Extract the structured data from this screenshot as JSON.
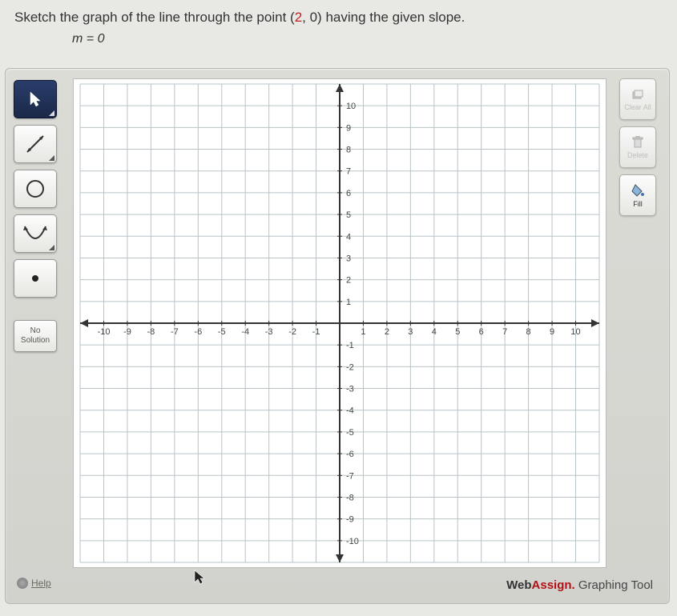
{
  "question": {
    "prefix": "Sketch the graph of the line through the point (",
    "point_x": "2",
    "mid": ", 0) having the given slope.",
    "equation": "m = 0"
  },
  "tools": {
    "no_solution_l1": "No",
    "no_solution_l2": "Solution"
  },
  "right": {
    "clear": "Clear All",
    "delete": "Delete",
    "fill": "Fill"
  },
  "help": "Help",
  "branding": {
    "web": "Web",
    "assign": "Assign.",
    "suffix": " Graphing Tool"
  },
  "chart_data": {
    "type": "scatter",
    "title": "",
    "xlabel": "",
    "ylabel": "",
    "xlim": [
      -11,
      11
    ],
    "ylim": [
      -11,
      11
    ],
    "xticks": [
      -10,
      -9,
      -8,
      -7,
      -6,
      -5,
      -4,
      -3,
      -2,
      -1,
      1,
      2,
      3,
      4,
      5,
      6,
      7,
      8,
      9,
      10
    ],
    "yticks": [
      -10,
      -9,
      -8,
      -7,
      -6,
      -5,
      -4,
      -3,
      -2,
      -1,
      1,
      2,
      3,
      4,
      5,
      6,
      7,
      8,
      9,
      10
    ],
    "series": []
  }
}
